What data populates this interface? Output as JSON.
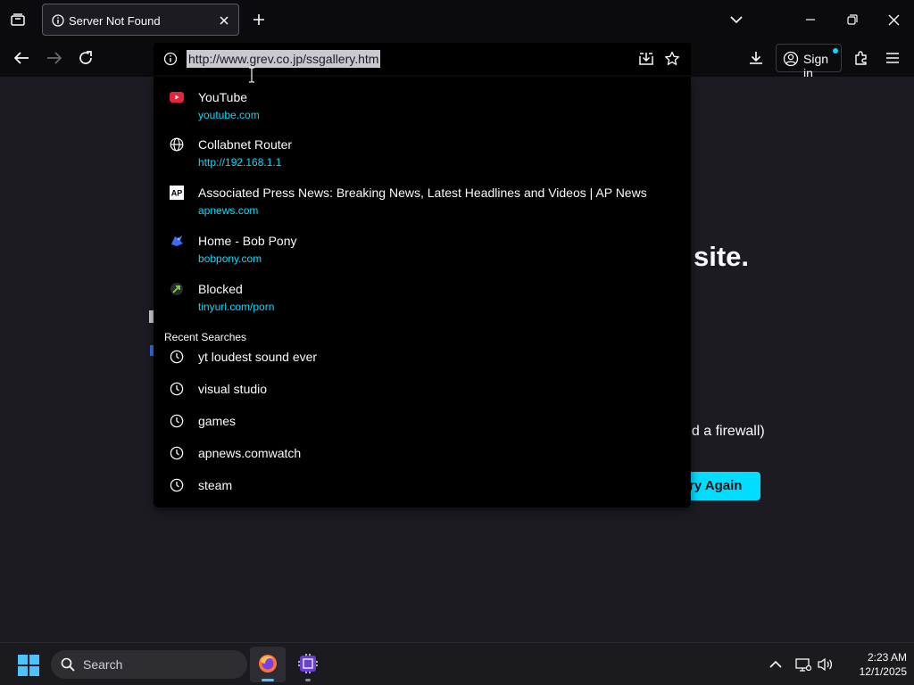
{
  "browser": {
    "tab": {
      "title": "Server Not Found"
    },
    "url": "http://www.grev.co.jp/ssgallery.htm",
    "sign_in_label": "Sign in"
  },
  "page_background": {
    "heading_fragment": "site.",
    "firewall_fragment": "nd a firewall)",
    "try_again_fragment": "ry Again"
  },
  "dropdown": {
    "suggestions": [
      {
        "title": "YouTube",
        "url": "youtube.com",
        "icon": "youtube-icon"
      },
      {
        "title": "Collabnet Router",
        "url": "http://192.168.1.1",
        "icon": "globe-icon"
      },
      {
        "title": "Associated Press News: Breaking News, Latest Headlines and Videos | AP News",
        "url": "apnews.com",
        "icon": "ap-icon"
      },
      {
        "title": "Home - Bob Pony",
        "url": "bobpony.com",
        "icon": "bobpony-icon"
      },
      {
        "title": "Blocked",
        "url": "tinyurl.com/porn",
        "icon": "tinyurl-icon"
      }
    ],
    "recent_header": "Recent Searches",
    "recent_searches": [
      "yt loudest sound ever",
      "visual studio",
      "games",
      "apnews.comwatch",
      "steam"
    ]
  },
  "taskbar": {
    "search_label": "Search",
    "time": "2:23 AM",
    "date": "12/1/2025"
  },
  "colors": {
    "accent": "#00ddff",
    "chrome": "#0b0b0d",
    "page": "#1c1b22"
  }
}
